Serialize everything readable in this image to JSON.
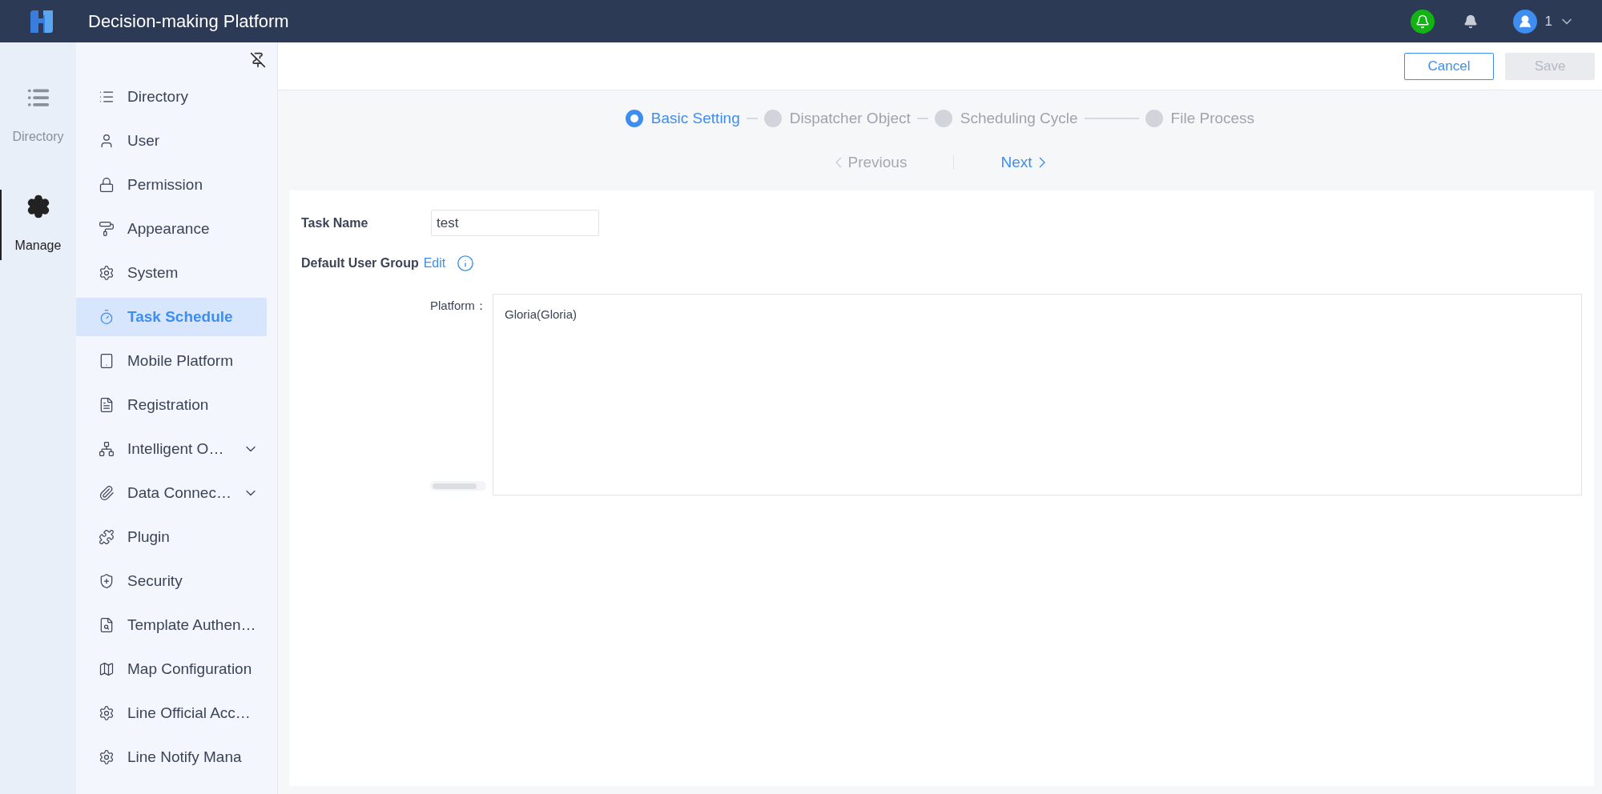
{
  "header": {
    "title": "Decision-making Platform",
    "user": "1"
  },
  "rail": [
    {
      "label": "Directory",
      "selected": false,
      "kind": "list"
    },
    {
      "label": "Manage",
      "selected": true,
      "kind": "gear"
    }
  ],
  "sidebar": {
    "items": [
      {
        "label": "Directory",
        "selected": false
      },
      {
        "label": "User",
        "selected": false
      },
      {
        "label": "Permission",
        "selected": false
      },
      {
        "label": "Appearance",
        "selected": false
      },
      {
        "label": "System",
        "selected": false
      },
      {
        "label": "Task Schedule",
        "selected": true
      },
      {
        "label": "Mobile Platform",
        "selected": false
      },
      {
        "label": "Registration",
        "selected": false
      },
      {
        "label": "Intelligent O…",
        "selected": false,
        "expandable": true
      },
      {
        "label": "Data Connec…",
        "selected": false,
        "expandable": true
      },
      {
        "label": "Plugin",
        "selected": false
      },
      {
        "label": "Security",
        "selected": false
      },
      {
        "label": "Template Authen…",
        "selected": false
      },
      {
        "label": "Map Configuration",
        "selected": false
      },
      {
        "label": "Line Official Acc…",
        "selected": false
      },
      {
        "label": "Line Notify Mana",
        "selected": false
      }
    ]
  },
  "toolbar": {
    "buttons": [
      {
        "label": "Cancel",
        "disabled": false
      },
      {
        "label": "Save",
        "disabled": true
      }
    ]
  },
  "steps": [
    {
      "label": "Basic Setting",
      "selected": true
    },
    {
      "label": "Dispatcher Object",
      "selected": false
    },
    {
      "label": "Scheduling Cycle",
      "selected": false
    },
    {
      "label": "File Process",
      "selected": false
    }
  ],
  "nav": [
    {
      "label": "Previous",
      "disabled": true,
      "kind": "prev"
    },
    {
      "label": "Next",
      "disabled": false,
      "kind": "next"
    }
  ],
  "form": {
    "task_name": {
      "label": "Task Name",
      "value": "test"
    },
    "default_user_group": {
      "label": "Default User Group",
      "link": "Edit"
    },
    "platform": {
      "label": "Platform",
      "separator": "：",
      "members": [
        "Gloria(Gloria)"
      ]
    }
  }
}
